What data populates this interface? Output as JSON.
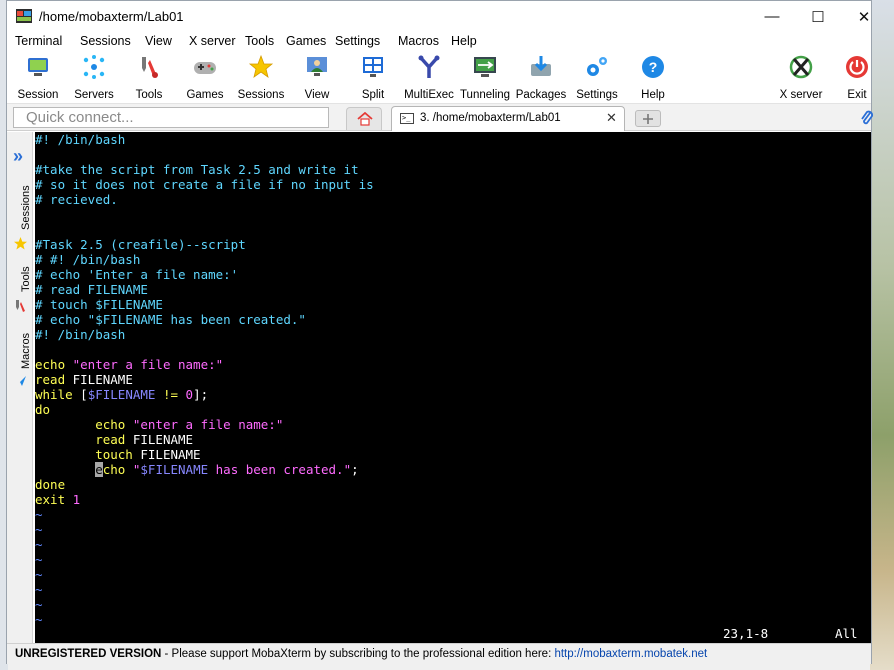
{
  "window": {
    "title": "/home/mobaxterm/Lab01",
    "minimize": "—",
    "maximize": "☐",
    "close": "✕"
  },
  "menu": [
    "Terminal",
    "Sessions",
    "View",
    "X server",
    "Tools",
    "Games",
    "Settings",
    "Macros",
    "Help"
  ],
  "toolbar": {
    "session": "Session",
    "servers": "Servers",
    "tools": "Tools",
    "games": "Games",
    "sessions": "Sessions",
    "view": "View",
    "split": "Split",
    "multiexec": "MultiExec",
    "tunneling": "Tunneling",
    "packages": "Packages",
    "settings": "Settings",
    "help": "Help",
    "xserver": "X server",
    "exit": "Exit"
  },
  "quick_connect": {
    "placeholder": "Quick connect..."
  },
  "tabs": {
    "active_label": "3. /home/mobaxterm/Lab01",
    "close": "✕"
  },
  "sidebar": {
    "sessions": "Sessions",
    "tools": "Tools",
    "macros": "Macros"
  },
  "terminal": {
    "lines": {
      "l0": "#! /bin/bash",
      "l2": "#take the script from Task 2.5 and write it",
      "l3": "# so it does not create a file if no input is",
      "l4": "# recieved.",
      "l7": "#Task 2.5 (creafile)--script",
      "l8": "# #! /bin/bash",
      "l9": "# echo 'Enter a file name:'",
      "l10": "# read FILENAME",
      "l11": "# touch $FILENAME",
      "l12": "# echo \"$FILENAME has been created.\"",
      "l13": "#! /bin/bash",
      "l15a": "echo",
      "l15b": " \"enter a file name:\"",
      "l16a": "read",
      "l16b": " FILENAME",
      "l17a": "while",
      "l17b": " [",
      "l17c": "$FILENAME",
      "l17d": " != ",
      "l17e": "0",
      "l17f": "];",
      "l18": "do",
      "l19a": "        echo",
      "l19b": " \"enter a file name:\"",
      "l20a": "        read",
      "l20b": " FILENAME",
      "l21a": "        touch",
      "l21b": " FILENAME",
      "l22pre": "        ",
      "l22cursor": "e",
      "l22a": "cho",
      "l22b": " \"",
      "l22c": "$FILENAME",
      "l22d": " has been created.\"",
      "l22e": ";",
      "l23": "done",
      "l24a": "exit",
      "l24b": " 1",
      "tilde": "~"
    },
    "position": "23,1-8",
    "scroll": "All"
  },
  "footer": {
    "version": "UNREGISTERED VERSION",
    "message": "  -  Please support MobaXterm by subscribing to the professional edition here:  ",
    "link": "http://mobaxterm.mobatek.net"
  }
}
